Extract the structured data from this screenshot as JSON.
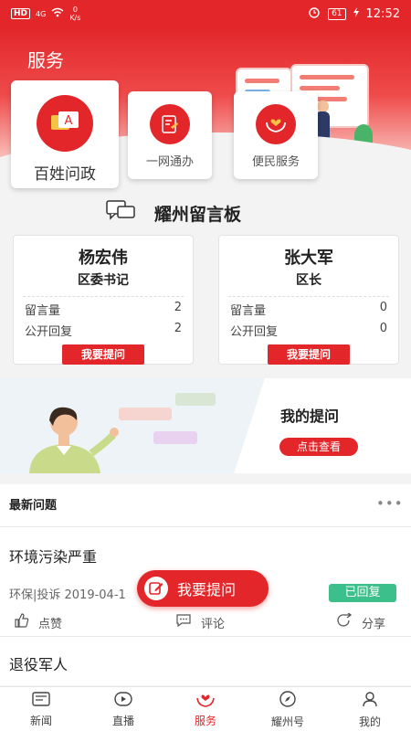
{
  "status_bar": {
    "hd": "HD",
    "network": "4G",
    "speed_value": "0",
    "speed_unit": "K/s",
    "battery": "61",
    "time": "12:52"
  },
  "header": {
    "title": "服务"
  },
  "services": [
    {
      "label": "百姓问政",
      "icon": "qa-icon"
    },
    {
      "label": "一网通办",
      "icon": "document-icon"
    },
    {
      "label": "便民服务",
      "icon": "heart-hands-icon"
    }
  ],
  "board": {
    "title": "耀州留言板",
    "cards": [
      {
        "name": "杨宏伟",
        "role": "区委书记",
        "msg_label": "留言量",
        "msg_count": "2",
        "reply_label": "公开回复",
        "reply_count": "2",
        "button": "我要提问"
      },
      {
        "name": "张大军",
        "role": "区长",
        "msg_label": "留言量",
        "msg_count": "0",
        "reply_label": "公开回复",
        "reply_count": "0",
        "button": "我要提问"
      }
    ]
  },
  "my_questions": {
    "title": "我的提问",
    "button": "点击查看"
  },
  "latest": {
    "title": "最新问题",
    "more": "•••",
    "items": [
      {
        "title": "环境污染严重",
        "meta": "环保|投诉    2019-04-1",
        "status": "已回复",
        "like": "点赞",
        "comment": "评论",
        "share": "分享"
      },
      {
        "title": "退役军人"
      }
    ]
  },
  "fab": {
    "label": "我要提问"
  },
  "tabs": [
    {
      "label": "新闻",
      "icon": "news-icon"
    },
    {
      "label": "直播",
      "icon": "play-icon"
    },
    {
      "label": "服务",
      "icon": "service-hands-icon"
    },
    {
      "label": "耀州号",
      "icon": "compass-icon"
    },
    {
      "label": "我的",
      "icon": "user-icon"
    }
  ],
  "colors": {
    "accent": "#e2262a",
    "success": "#3cbf8a"
  }
}
